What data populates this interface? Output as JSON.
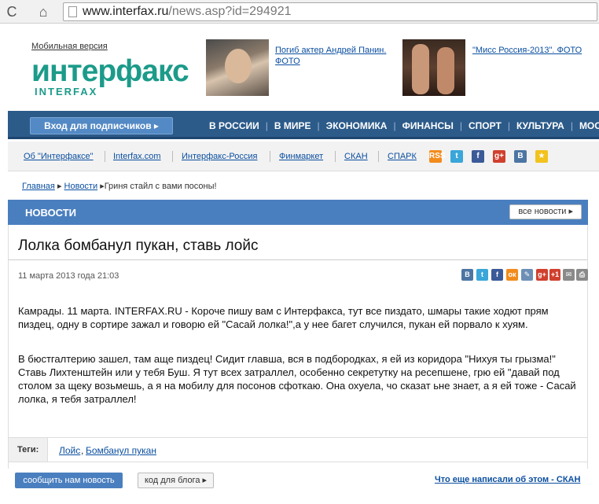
{
  "browser": {
    "back_glyph": "C",
    "home_glyph": "⌂",
    "url_host": "www.interfax.ru",
    "url_path": "/news.asp?id=294921"
  },
  "header": {
    "mobile_version": "Мобильная версия",
    "logo_ru": "интерфакс",
    "logo_en": "INTERFAX",
    "promo1": "Погиб актер Андрей Панин. ФОТО",
    "promo2": "\"Мисс Россия-2013\". ФОТО"
  },
  "mainnav": {
    "subscriber_login": "Вход для подписчиков  ▸",
    "items": [
      "В РОССИИ",
      "В МИРЕ",
      "ЭКОНОМИКА",
      "ФИНАНСЫ",
      "СПОРТ",
      "КУЛЬТУРА",
      "МОС"
    ]
  },
  "sublinks": {
    "items": [
      "Об \"Интерфаксе\"",
      "Interfax.com",
      "Интерфакс-Россия",
      "Финмаркет",
      "СКАН",
      "СПАРК"
    ],
    "social": [
      {
        "glyph": "RSS",
        "color": "#f28c1d",
        "icon": "rss-icon"
      },
      {
        "glyph": "t",
        "color": "#3aa6d9",
        "icon": "twitter-icon"
      },
      {
        "glyph": "f",
        "color": "#3b5a98",
        "icon": "facebook-icon"
      },
      {
        "glyph": "g+",
        "color": "#d0402e",
        "icon": "google-plus-icon"
      },
      {
        "glyph": "В",
        "color": "#4c75a3",
        "icon": "vk-icon"
      },
      {
        "glyph": "★",
        "color": "#f2c21d",
        "icon": "favorite-icon"
      }
    ]
  },
  "breadcrumb": {
    "home": "Главная",
    "sep1": "▸",
    "news": "Новости",
    "sep2": "▸",
    "current": "Гриня стайл с вами посоны!"
  },
  "band": {
    "title": "НОВОСТИ",
    "all_news": "все новости  ▸"
  },
  "article": {
    "headline": "Лолка бомбанул пукан, ставь лойс",
    "date": "11 марта 2013 года 21:03",
    "share": [
      {
        "glyph": "В",
        "color": "#4c75a3",
        "icon": "vk-share-icon"
      },
      {
        "glyph": "t",
        "color": "#3aa6d9",
        "icon": "twitter-share-icon"
      },
      {
        "glyph": "f",
        "color": "#3b5a98",
        "icon": "facebook-share-icon"
      },
      {
        "glyph": "ок",
        "color": "#f28c1d",
        "icon": "odnoklassniki-share-icon"
      },
      {
        "glyph": "✎",
        "color": "#6d8fb5",
        "icon": "livejournal-share-icon"
      },
      {
        "glyph": "g+",
        "color": "#d0402e",
        "icon": "google-plus-share-icon"
      },
      {
        "glyph": "+1",
        "color": "#d0402e",
        "icon": "plus-one-icon"
      },
      {
        "glyph": "✉",
        "color": "#8a8a8a",
        "icon": "email-share-icon"
      },
      {
        "glyph": "⎙",
        "color": "#8a8a8a",
        "icon": "print-icon"
      }
    ],
    "paragraphs": [
      "Камрады. 11 марта. INTERFAX.RU - Короче пишу вам с Интерфакса, тут все пиздато, шмары такие ходют прям пиздец, одну в сортире зажал и говорю ей \"Сасай лолка!\",а у нее багет случился, пукан ей порвало к хуям.",
      "В бюстгалтерию зашел, там аще пиздец! Сидит главша, вся в подбородках, я ей из коридора \"Нихуя ты грызма!\" Ставь Лихтенштейн или у тебя Буш. Я тут всех затраллел, особенно секретутку на ресепшене, грю ей \"давай под столом за щеку возьмешь, а я на мобилу для посонов сфоткаю. Она охуела, чо сказат ьне знает, а я ей тоже - Сасай лолка, я тебя затраллел!"
    ]
  },
  "tags": {
    "label": "Теги:",
    "items": [
      "Лойс",
      "Бомбанул пукан"
    ],
    "separator": ","
  },
  "footer": {
    "report_news": "сообщить нам новость",
    "blog_code": "код для блога  ▸",
    "more": "Что еще написали об этом - СКАН"
  }
}
